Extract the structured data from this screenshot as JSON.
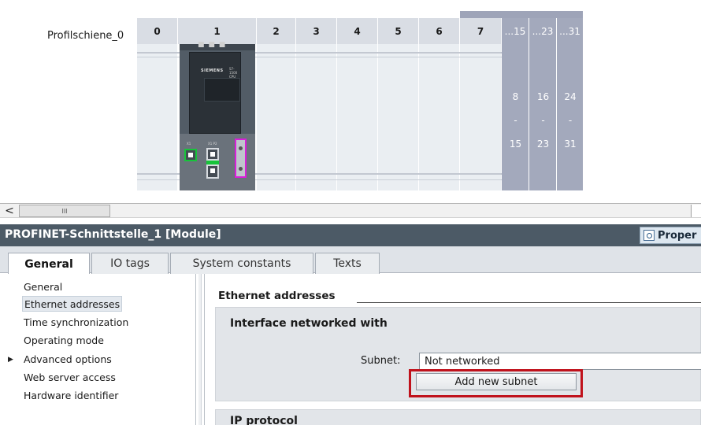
{
  "rack": {
    "rail_name": "Profilschiene_0",
    "slots": [
      "0",
      "1",
      "2",
      "3",
      "4",
      "5",
      "6",
      "7"
    ],
    "range_headers": [
      "...15",
      "...23",
      "...31"
    ],
    "range_bodies": [
      {
        "start": "8",
        "sep": "-",
        "end": "15"
      },
      {
        "start": "16",
        "sep": "-",
        "end": "23"
      },
      {
        "start": "24",
        "sep": "-",
        "end": "31"
      }
    ],
    "cpu": {
      "brand": "SIEMENS",
      "model_line1": "S7-1500",
      "model_line2": "CPU"
    }
  },
  "scrollbar": {
    "left_arrow": "<",
    "thumb_grip": "III"
  },
  "properties": {
    "title": "PROFINET-Schnittstelle_1 [Module]",
    "properties_button": "Proper"
  },
  "tabs": [
    "General",
    "IO tags",
    "System constants",
    "Texts"
  ],
  "nav": {
    "items": [
      {
        "label": "General"
      },
      {
        "label": "Ethernet addresses",
        "selected": true
      },
      {
        "label": "Time synchronization"
      },
      {
        "label": "Operating mode"
      },
      {
        "label": "Advanced options",
        "expandable": true
      },
      {
        "label": "Web server access"
      },
      {
        "label": "Hardware identifier"
      }
    ],
    "caret": "▶"
  },
  "content": {
    "section_heading": "Ethernet addresses",
    "panel_title": "Interface networked with",
    "subnet_label": "Subnet:",
    "subnet_value": "Not networked",
    "add_subnet_button": "Add new subnet",
    "next_panel_title": "IP protocol"
  },
  "colors": {
    "title_bar": "#4c5a66",
    "highlight": "#c0121c",
    "port_green": "#17c43a",
    "connector_magenta": "#d91ed9",
    "rack_gray": "#a3a9bc"
  }
}
